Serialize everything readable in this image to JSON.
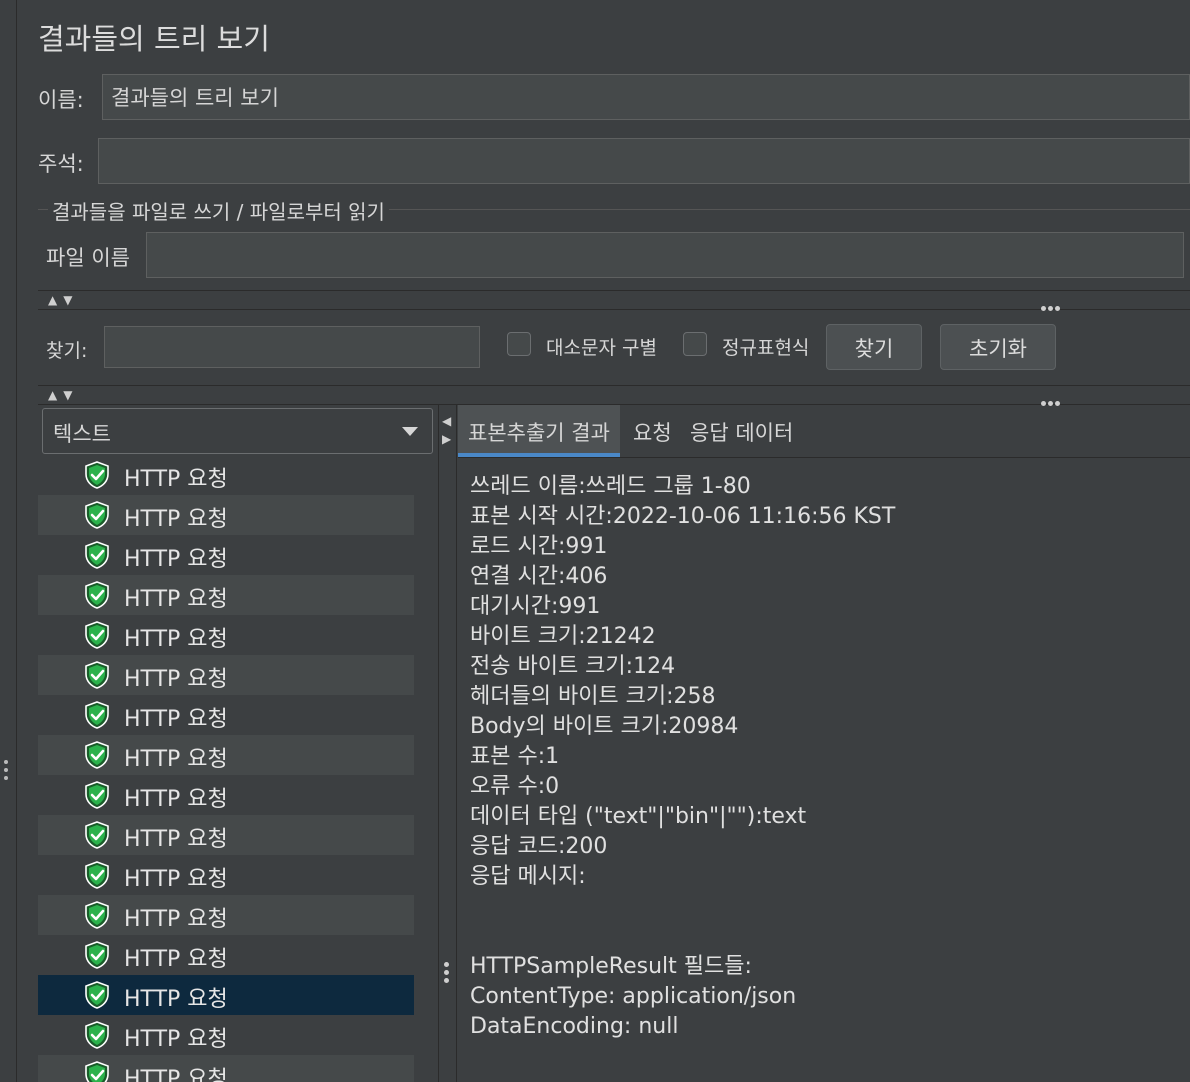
{
  "window": {
    "title": "결과들의 트리 보기"
  },
  "name_field": {
    "label": "이름:",
    "value": "결과들의 트리 보기"
  },
  "comment_field": {
    "label": "주석:",
    "value": ""
  },
  "file_section": {
    "legend": "결과들을 파일로 쓰기 / 파일로부터 읽기",
    "filename_label": "파일 이름",
    "filename_value": ""
  },
  "search": {
    "label": "찾기:",
    "value": "",
    "case_sensitive_label": "대소문자 구별",
    "regex_label": "정규표현식",
    "find_button": "찾기",
    "reset_button": "초기화"
  },
  "renderer_select": {
    "value": "텍스트"
  },
  "tree": {
    "items": [
      {
        "label": "HTTP 요청"
      },
      {
        "label": "HTTP 요청"
      },
      {
        "label": "HTTP 요청"
      },
      {
        "label": "HTTP 요청"
      },
      {
        "label": "HTTP 요청"
      },
      {
        "label": "HTTP 요청"
      },
      {
        "label": "HTTP 요청"
      },
      {
        "label": "HTTP 요청"
      },
      {
        "label": "HTTP 요청"
      },
      {
        "label": "HTTP 요청"
      },
      {
        "label": "HTTP 요청"
      },
      {
        "label": "HTTP 요청"
      },
      {
        "label": "HTTP 요청"
      },
      {
        "label": "HTTP 요청"
      },
      {
        "label": "HTTP 요청"
      },
      {
        "label": "HTTP 요청"
      }
    ],
    "selected_index": 13,
    "status_icon": "success-shield-icon",
    "icon_color": "#2bb24c"
  },
  "tabs": [
    {
      "label": "표본추출기 결과"
    },
    {
      "label": "요청"
    },
    {
      "label": "응답 데이터"
    }
  ],
  "result_lines": [
    "쓰레드 이름:쓰레드 그룹 1-80",
    "표본 시작 시간:2022-10-06 11:16:56 KST",
    "로드 시간:991",
    "연결 시간:406",
    "대기시간:991",
    "바이트 크기:21242",
    "전송 바이트 크기:124",
    "헤더들의 바이트 크기:258",
    "Body의 바이트 크기:20984",
    "표본 수:1",
    "오류 수:0",
    "데이터 타입 (\"text\"|\"bin\"|\"\"):text",
    "응답 코드:200",
    "응답 메시지:",
    "",
    "",
    "HTTPSampleResult 필드들:",
    "ContentType: application/json",
    "DataEncoding: null"
  ],
  "colors": {
    "accent": "#4a88c7",
    "selection": "#0d293e",
    "background": "#3c3f41"
  }
}
